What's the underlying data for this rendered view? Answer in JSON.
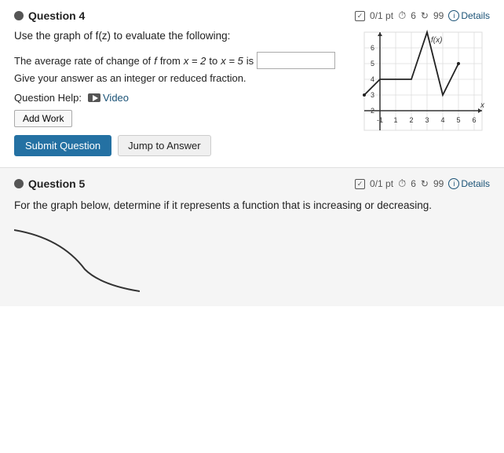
{
  "question4": {
    "title": "Question 4",
    "meta": {
      "points": "0/1 pt",
      "tries": "6",
      "recycle": "99",
      "details": "Details"
    },
    "instruction": "Use the graph of f(z) to evaluate the following:",
    "avg_rate_label_prefix": "The average rate of change of",
    "avg_rate_f": "f",
    "avg_rate_label_mid": "from",
    "avg_rate_x1": "x = 2",
    "avg_rate_to": "to",
    "avg_rate_x2": "x = 5",
    "avg_rate_suffix": "is",
    "sub_instruction": "Give your answer as an integer or reduced fraction.",
    "help_label": "Question Help:",
    "video_label": "Video",
    "add_work_label": "Add Work",
    "submit_label": "Submit Question",
    "jump_label": "Jump to Answer"
  },
  "question5": {
    "title": "Question 5",
    "meta": {
      "points": "0/1 pt",
      "tries": "6",
      "recycle": "99",
      "details": "Details"
    },
    "instruction": "For the graph below, determine if it represents a function that is increasing or decreasing."
  }
}
